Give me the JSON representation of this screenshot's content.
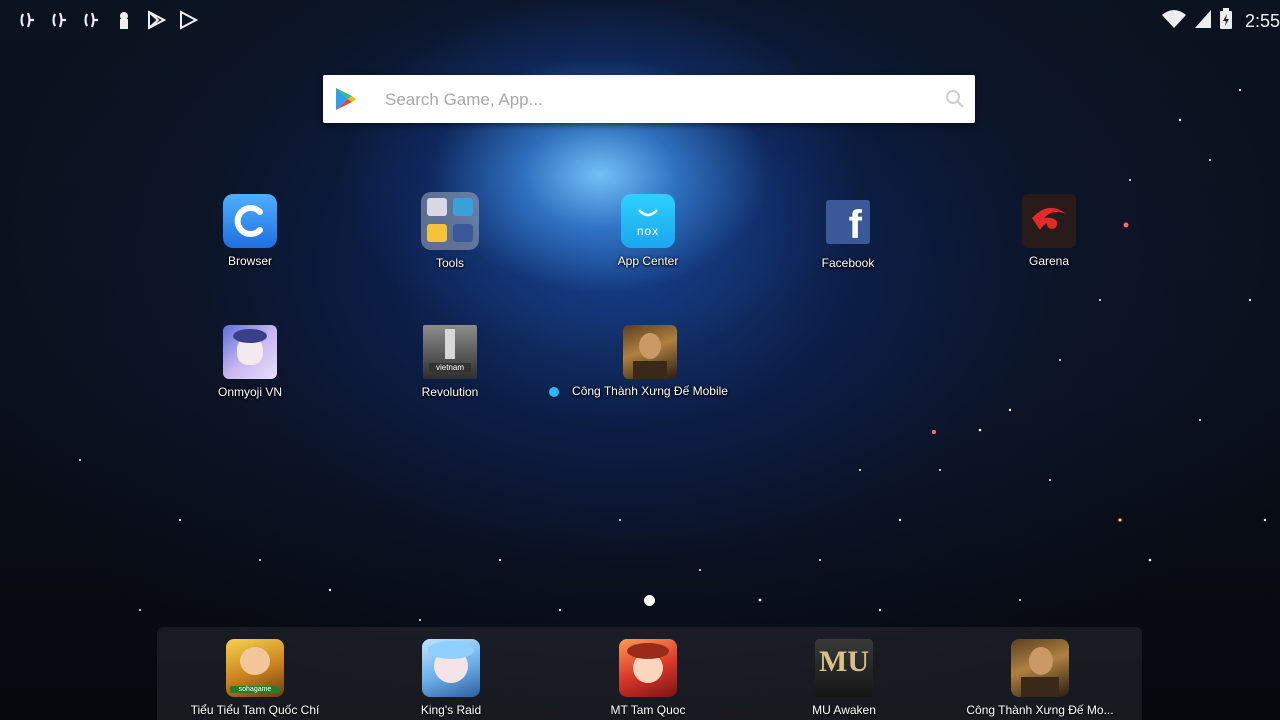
{
  "status_bar": {
    "time": "2:55",
    "left_icons": [
      "notification-icon",
      "notification-icon",
      "notification-icon",
      "keyhole-icon",
      "play-store-icon",
      "play-store-icon"
    ],
    "right_icons": [
      "wifi-icon",
      "signal-icon",
      "battery-charging-icon"
    ]
  },
  "search": {
    "placeholder": "Search Game, App..."
  },
  "desktop_apps": [
    {
      "label": "Browser"
    },
    {
      "label": "Tools"
    },
    {
      "label": "App Center",
      "icon_text": "nox"
    },
    {
      "label": "Facebook",
      "icon_text": "f"
    },
    {
      "label": "Garena"
    },
    {
      "label": "Onmyoji VN"
    },
    {
      "label": "Revolution",
      "icon_text": "vietnam"
    },
    {
      "label": "Công Thành Xưng Đế Mobile"
    }
  ],
  "dock_apps": [
    {
      "label": "Tiểu Tiểu Tam Quốc Chí",
      "icon_text": "sohagame"
    },
    {
      "label": "King's Raid"
    },
    {
      "label": "MT Tam Quoc"
    },
    {
      "label": "MU Awaken",
      "icon_text": "MU"
    },
    {
      "label": "Công Thành Xưng Đế Mo..."
    }
  ],
  "pager": {
    "current": 1,
    "total": 1
  },
  "colors": {
    "accent_blue": "#2bb8f0",
    "browser_blue": "#2f8ff0",
    "facebook_blue": "#3b5998",
    "garena_red": "#e12a2a"
  }
}
